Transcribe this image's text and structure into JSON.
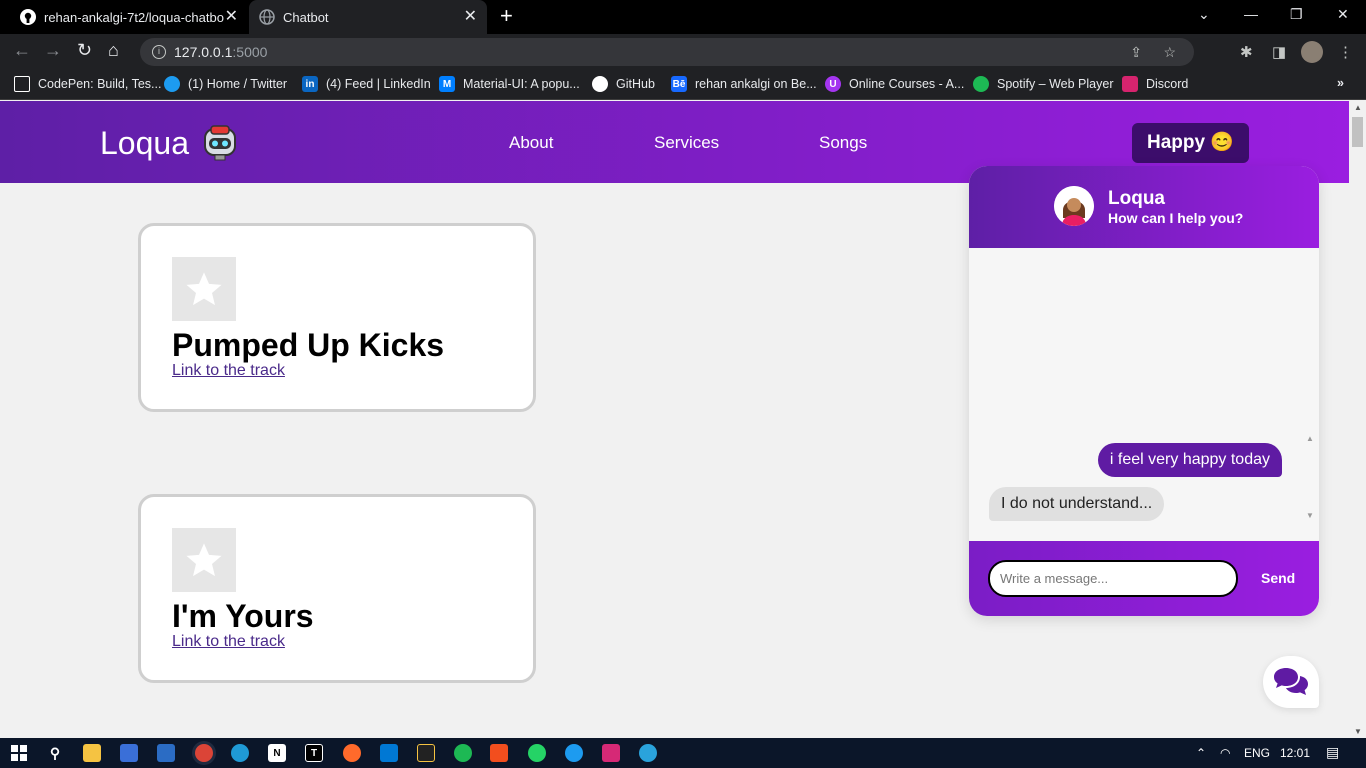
{
  "browser": {
    "tabs": [
      {
        "title": "rehan-ankalgi-7t2/loqua-chatbot",
        "icon": "github-icon"
      },
      {
        "title": "Chatbot",
        "icon": "globe-icon"
      }
    ],
    "url_host": "127.0.0.1",
    "url_port": ":5000",
    "bookmarks": [
      {
        "label": "CodePen: Build, Tes...",
        "icon": "codepen-icon",
        "color": "#ffffff"
      },
      {
        "label": "(1) Home / Twitter",
        "icon": "twitter-icon",
        "color": "#1d9bf0"
      },
      {
        "label": "(4) Feed | LinkedIn",
        "icon": "linkedin-icon",
        "color": "#0a66c2"
      },
      {
        "label": "Material-UI: A popu...",
        "icon": "mui-icon",
        "color": "#007fff"
      },
      {
        "label": "GitHub",
        "icon": "github-icon",
        "color": "#ffffff"
      },
      {
        "label": "rehan ankalgi on Be...",
        "icon": "behance-icon",
        "color": "#1769ff"
      },
      {
        "label": "Online Courses - A...",
        "icon": "udemy-icon",
        "color": "#a435f0"
      },
      {
        "label": "Spotify – Web Player",
        "icon": "spotify-icon",
        "color": "#1db954"
      },
      {
        "label": "Discord",
        "icon": "discord-icon",
        "color": "#d6246e"
      }
    ]
  },
  "site": {
    "logo": "Loqua",
    "nav": [
      "About",
      "Services",
      "Songs"
    ],
    "mood_label": "Happy 😊",
    "songs": [
      {
        "title": "Pumped Up Kicks",
        "link": "Link to the track"
      },
      {
        "title": "I'm Yours",
        "link": "Link to the track"
      }
    ]
  },
  "chat": {
    "name": "Loqua",
    "subtitle": "How can I help you?",
    "messages": [
      {
        "from": "user",
        "text": "i feel very happy today"
      },
      {
        "from": "bot",
        "text": "I do not understand..."
      }
    ],
    "input_placeholder": "Write a message...",
    "send_label": "Send"
  },
  "system": {
    "language": "ENG",
    "time": "12:01"
  },
  "colors": {
    "accent_dark": "#5e1fa6",
    "accent_light": "#9a1ee0",
    "mood_button": "#3c0d6b",
    "user_bubble": "#5f1ba3"
  }
}
